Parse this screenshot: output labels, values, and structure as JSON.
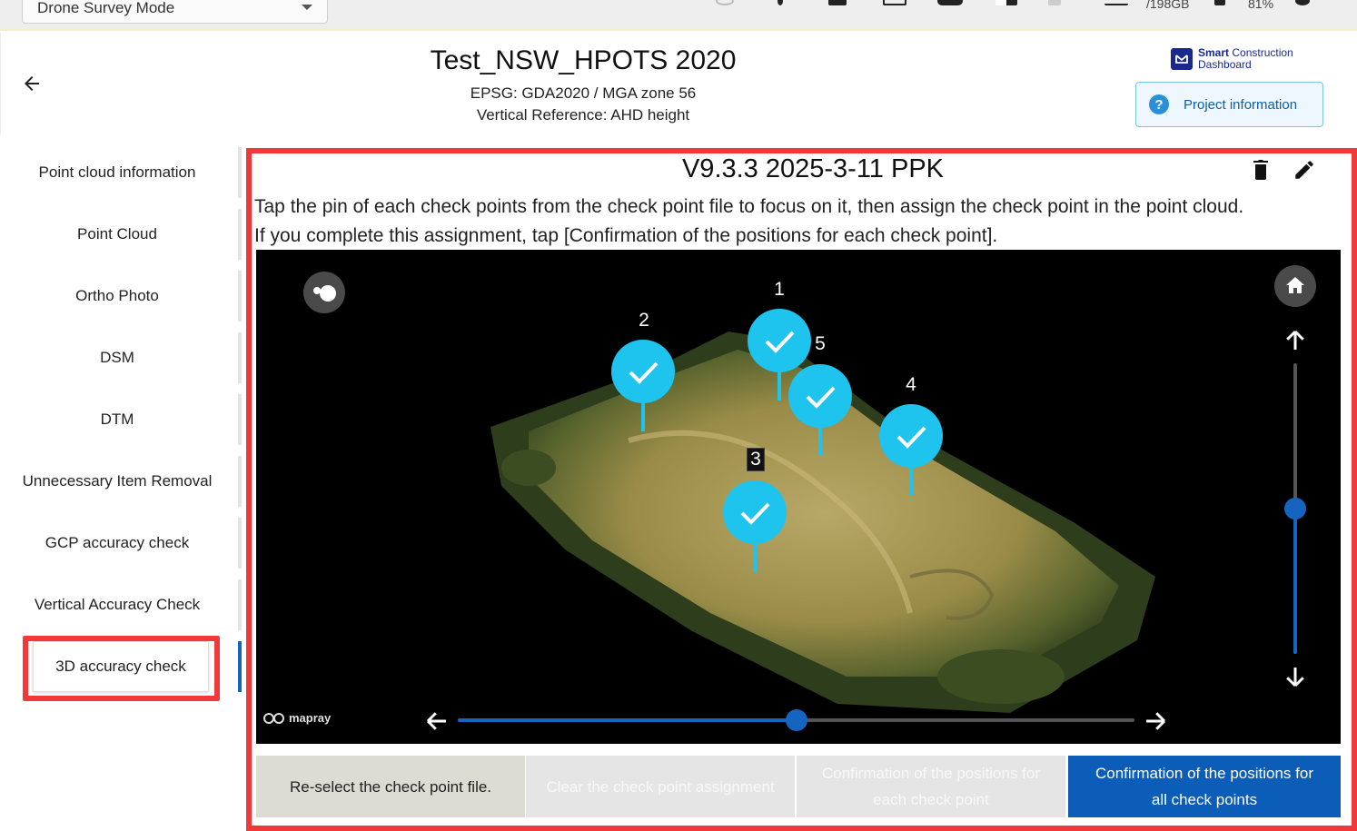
{
  "topbar": {
    "mode": "Drone Survey Mode",
    "storage_text": "/198GB",
    "battery_text": "81%"
  },
  "header": {
    "title": "Test_NSW_HPOTS 2020",
    "epsg": "EPSG: GDA2020 / MGA zone 56",
    "vertical_reference": "Vertical Reference: AHD height",
    "logo_bold": "Smart",
    "logo_rest": " Construction",
    "logo_line2": "Dashboard",
    "project_info_label": "Project information"
  },
  "sidebar": {
    "items": [
      {
        "label": "Point cloud information"
      },
      {
        "label": "Point Cloud"
      },
      {
        "label": "Ortho Photo"
      },
      {
        "label": "DSM"
      },
      {
        "label": "DTM"
      },
      {
        "label": "Unnecessary Item Removal"
      },
      {
        "label": "GCP accuracy check"
      },
      {
        "label": "Vertical Accuracy Check"
      },
      {
        "label": "3D accuracy check"
      }
    ],
    "active_index": 8
  },
  "main": {
    "title": "V9.3.3 2025-3-11 PPK",
    "instruction_line1": "Tap the pin of each check points from the check point file to focus on it, then assign the check point in the point cloud.",
    "instruction_line2": "If you complete this assignment, tap [Confirmation of the positions for each check point].",
    "viewer": {
      "watermark": "mapray",
      "pins": [
        {
          "label": "1",
          "confirmed": true
        },
        {
          "label": "2",
          "confirmed": true
        },
        {
          "label": "3",
          "confirmed": true
        },
        {
          "label": "4",
          "confirmed": true
        },
        {
          "label": "5",
          "confirmed": true
        }
      ],
      "horizontal_slider_value": 0.5,
      "vertical_slider_value": 0.5
    },
    "buttons": {
      "reselect": "Re-select the check point file.",
      "clear": "Clear the check point assignment",
      "confirm_each": "Confirmation of the positions for each check point",
      "confirm_all": "Confirmation of the positions for all check points"
    }
  },
  "colors": {
    "accent": "#0c5db8",
    "highlight": "#f2393a",
    "pin": "#1ec4ee"
  }
}
